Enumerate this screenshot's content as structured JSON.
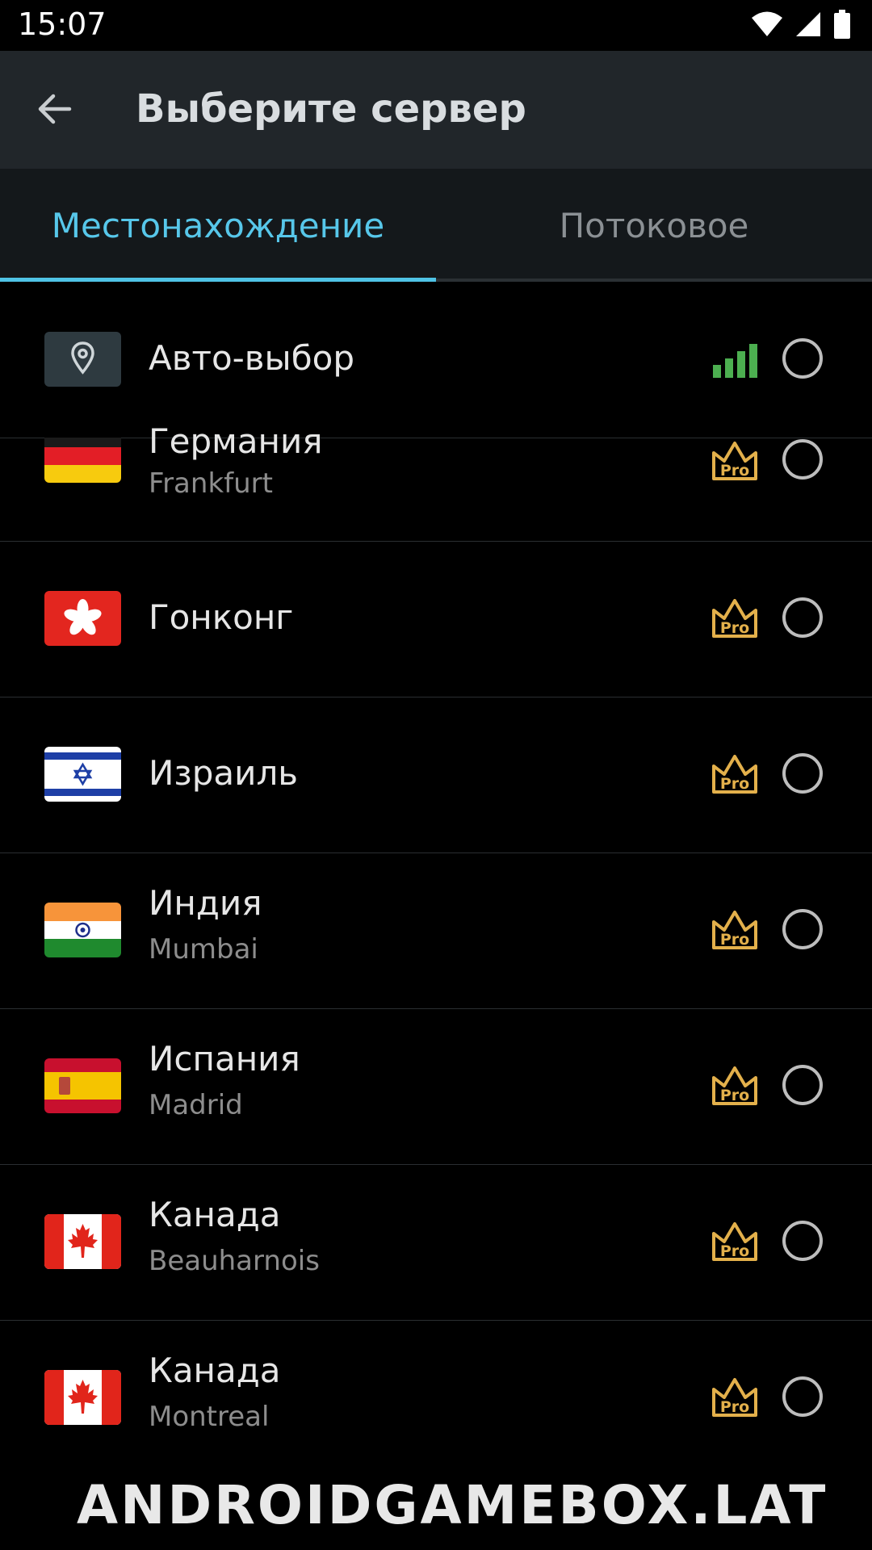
{
  "status_bar": {
    "time": "15:07"
  },
  "app_bar": {
    "title": "Выберите сервер"
  },
  "tabs": [
    {
      "label": "Местонахождение",
      "active": true
    },
    {
      "label": "Потоковое",
      "active": false
    }
  ],
  "servers": [
    {
      "name": "Авто-выбор",
      "city": "",
      "badge": "signal",
      "icon": "location-pin-icon"
    },
    {
      "name": "Германия",
      "city": "Frankfurt",
      "badge": "Pro",
      "icon": "flag-germany-icon"
    },
    {
      "name": "Гонконг",
      "city": "",
      "badge": "Pro",
      "icon": "flag-hong-kong-icon"
    },
    {
      "name": "Израиль",
      "city": "",
      "badge": "Pro",
      "icon": "flag-israel-icon"
    },
    {
      "name": "Индия",
      "city": "Mumbai",
      "badge": "Pro",
      "icon": "flag-india-icon"
    },
    {
      "name": "Испания",
      "city": "Madrid",
      "badge": "Pro",
      "icon": "flag-spain-icon"
    },
    {
      "name": "Канада",
      "city": "Beauharnois",
      "badge": "Pro",
      "icon": "flag-canada-icon"
    },
    {
      "name": "Канада",
      "city": "Montreal",
      "badge": "Pro",
      "icon": "flag-canada-icon"
    }
  ],
  "pro_label": "Pro",
  "watermark": "ANDROIDGAMEBOX.LAT",
  "colors": {
    "accent": "#4fc3e6",
    "pro": "#e3b04b",
    "signal": "#4caf50",
    "app_bar": "#21262a"
  }
}
